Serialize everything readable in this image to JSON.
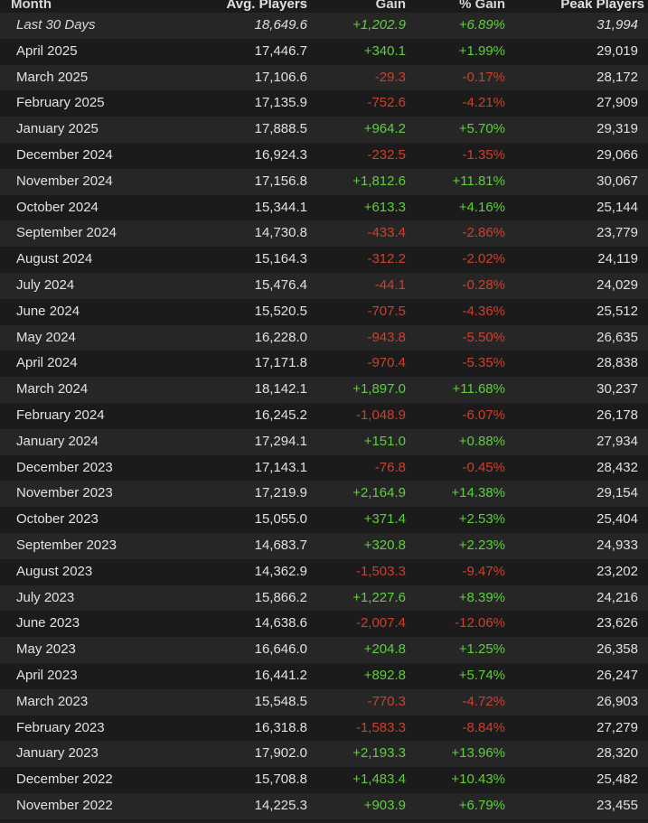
{
  "colors": {
    "positive": "#5fce3d",
    "negative": "#c9412f",
    "row_alt": "#262626",
    "background": "#1b1b1b"
  },
  "headers": {
    "month": "Month",
    "avg": "Avg. Players",
    "gain": "Gain",
    "pct": "% Gain",
    "peak": "Peak Players"
  },
  "rows": [
    {
      "month": "Last 30 Days",
      "avg": "18,649.6",
      "gain": "+1,202.9",
      "pct": "+6.89%",
      "peak": "31,994"
    },
    {
      "month": "April 2025",
      "avg": "17,446.7",
      "gain": "+340.1",
      "pct": "+1.99%",
      "peak": "29,019"
    },
    {
      "month": "March 2025",
      "avg": "17,106.6",
      "gain": "-29.3",
      "pct": "-0.17%",
      "peak": "28,172"
    },
    {
      "month": "February 2025",
      "avg": "17,135.9",
      "gain": "-752.6",
      "pct": "-4.21%",
      "peak": "27,909"
    },
    {
      "month": "January 2025",
      "avg": "17,888.5",
      "gain": "+964.2",
      "pct": "+5.70%",
      "peak": "29,319"
    },
    {
      "month": "December 2024",
      "avg": "16,924.3",
      "gain": "-232.5",
      "pct": "-1.35%",
      "peak": "29,066"
    },
    {
      "month": "November 2024",
      "avg": "17,156.8",
      "gain": "+1,812.6",
      "pct": "+11.81%",
      "peak": "30,067"
    },
    {
      "month": "October 2024",
      "avg": "15,344.1",
      "gain": "+613.3",
      "pct": "+4.16%",
      "peak": "25,144"
    },
    {
      "month": "September 2024",
      "avg": "14,730.8",
      "gain": "-433.4",
      "pct": "-2.86%",
      "peak": "23,779"
    },
    {
      "month": "August 2024",
      "avg": "15,164.3",
      "gain": "-312.2",
      "pct": "-2.02%",
      "peak": "24,119"
    },
    {
      "month": "July 2024",
      "avg": "15,476.4",
      "gain": "-44.1",
      "pct": "-0.28%",
      "peak": "24,029"
    },
    {
      "month": "June 2024",
      "avg": "15,520.5",
      "gain": "-707.5",
      "pct": "-4.36%",
      "peak": "25,512"
    },
    {
      "month": "May 2024",
      "avg": "16,228.0",
      "gain": "-943.8",
      "pct": "-5.50%",
      "peak": "26,635"
    },
    {
      "month": "April 2024",
      "avg": "17,171.8",
      "gain": "-970.4",
      "pct": "-5.35%",
      "peak": "28,838"
    },
    {
      "month": "March 2024",
      "avg": "18,142.1",
      "gain": "+1,897.0",
      "pct": "+11.68%",
      "peak": "30,237"
    },
    {
      "month": "February 2024",
      "avg": "16,245.2",
      "gain": "-1,048.9",
      "pct": "-6.07%",
      "peak": "26,178"
    },
    {
      "month": "January 2024",
      "avg": "17,294.1",
      "gain": "+151.0",
      "pct": "+0.88%",
      "peak": "27,934"
    },
    {
      "month": "December 2023",
      "avg": "17,143.1",
      "gain": "-76.8",
      "pct": "-0.45%",
      "peak": "28,432"
    },
    {
      "month": "November 2023",
      "avg": "17,219.9",
      "gain": "+2,164.9",
      "pct": "+14.38%",
      "peak": "29,154"
    },
    {
      "month": "October 2023",
      "avg": "15,055.0",
      "gain": "+371.4",
      "pct": "+2.53%",
      "peak": "25,404"
    },
    {
      "month": "September 2023",
      "avg": "14,683.7",
      "gain": "+320.8",
      "pct": "+2.23%",
      "peak": "24,933"
    },
    {
      "month": "August 2023",
      "avg": "14,362.9",
      "gain": "-1,503.3",
      "pct": "-9.47%",
      "peak": "23,202"
    },
    {
      "month": "July 2023",
      "avg": "15,866.2",
      "gain": "+1,227.6",
      "pct": "+8.39%",
      "peak": "24,216"
    },
    {
      "month": "June 2023",
      "avg": "14,638.6",
      "gain": "-2,007.4",
      "pct": "-12.06%",
      "peak": "23,626"
    },
    {
      "month": "May 2023",
      "avg": "16,646.0",
      "gain": "+204.8",
      "pct": "+1.25%",
      "peak": "26,358"
    },
    {
      "month": "April 2023",
      "avg": "16,441.2",
      "gain": "+892.8",
      "pct": "+5.74%",
      "peak": "26,247"
    },
    {
      "month": "March 2023",
      "avg": "15,548.5",
      "gain": "-770.3",
      "pct": "-4.72%",
      "peak": "26,903"
    },
    {
      "month": "February 2023",
      "avg": "16,318.8",
      "gain": "-1,583.3",
      "pct": "-8.84%",
      "peak": "27,279"
    },
    {
      "month": "January 2023",
      "avg": "17,902.0",
      "gain": "+2,193.3",
      "pct": "+13.96%",
      "peak": "28,320"
    },
    {
      "month": "December 2022",
      "avg": "15,708.8",
      "gain": "+1,483.4",
      "pct": "+10.43%",
      "peak": "25,482"
    },
    {
      "month": "November 2022",
      "avg": "14,225.3",
      "gain": "+903.9",
      "pct": "+6.79%",
      "peak": "23,455"
    }
  ]
}
